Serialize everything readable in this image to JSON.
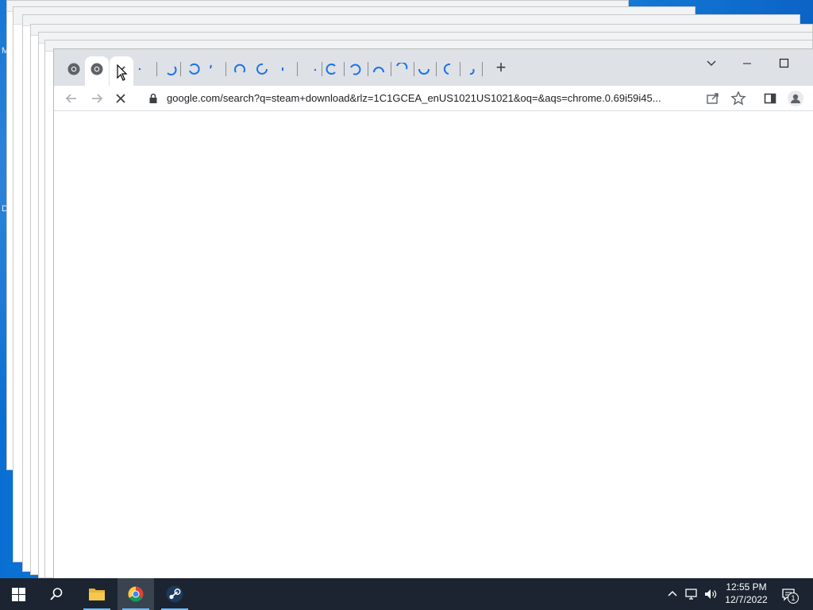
{
  "desktop": {
    "left_labels": [
      "M",
      "D"
    ]
  },
  "browser": {
    "tabs": [
      {
        "kind": "favicon",
        "icon": "chrome-icon"
      },
      {
        "kind": "favicon",
        "icon": "chrome-icon",
        "active": true
      },
      {
        "kind": "close",
        "icon": "close-icon"
      }
    ],
    "loading_tabs_count": 16,
    "new_tab_label": "+",
    "address_url": "google.com/search?q=steam+download&rlz=1C1GCEA_enUS1021US1021&oq=&aqs=chrome.0.69i59i45...",
    "loading": true
  },
  "taskbar": {
    "apps": [
      {
        "name": "start",
        "icon": "windows-start-icon"
      },
      {
        "name": "search",
        "icon": "search-icon"
      },
      {
        "name": "file-explorer",
        "icon": "folder-icon"
      },
      {
        "name": "chrome",
        "icon": "chrome-icon",
        "active": true
      },
      {
        "name": "steam",
        "icon": "steam-icon"
      }
    ],
    "clock_time": "12:55 PM",
    "clock_date": "12/7/2022",
    "notification_count": "1"
  },
  "colors": {
    "accent": "#1a73e8",
    "taskbar": "#1b2430",
    "tabstrip": "#dee1e6"
  }
}
